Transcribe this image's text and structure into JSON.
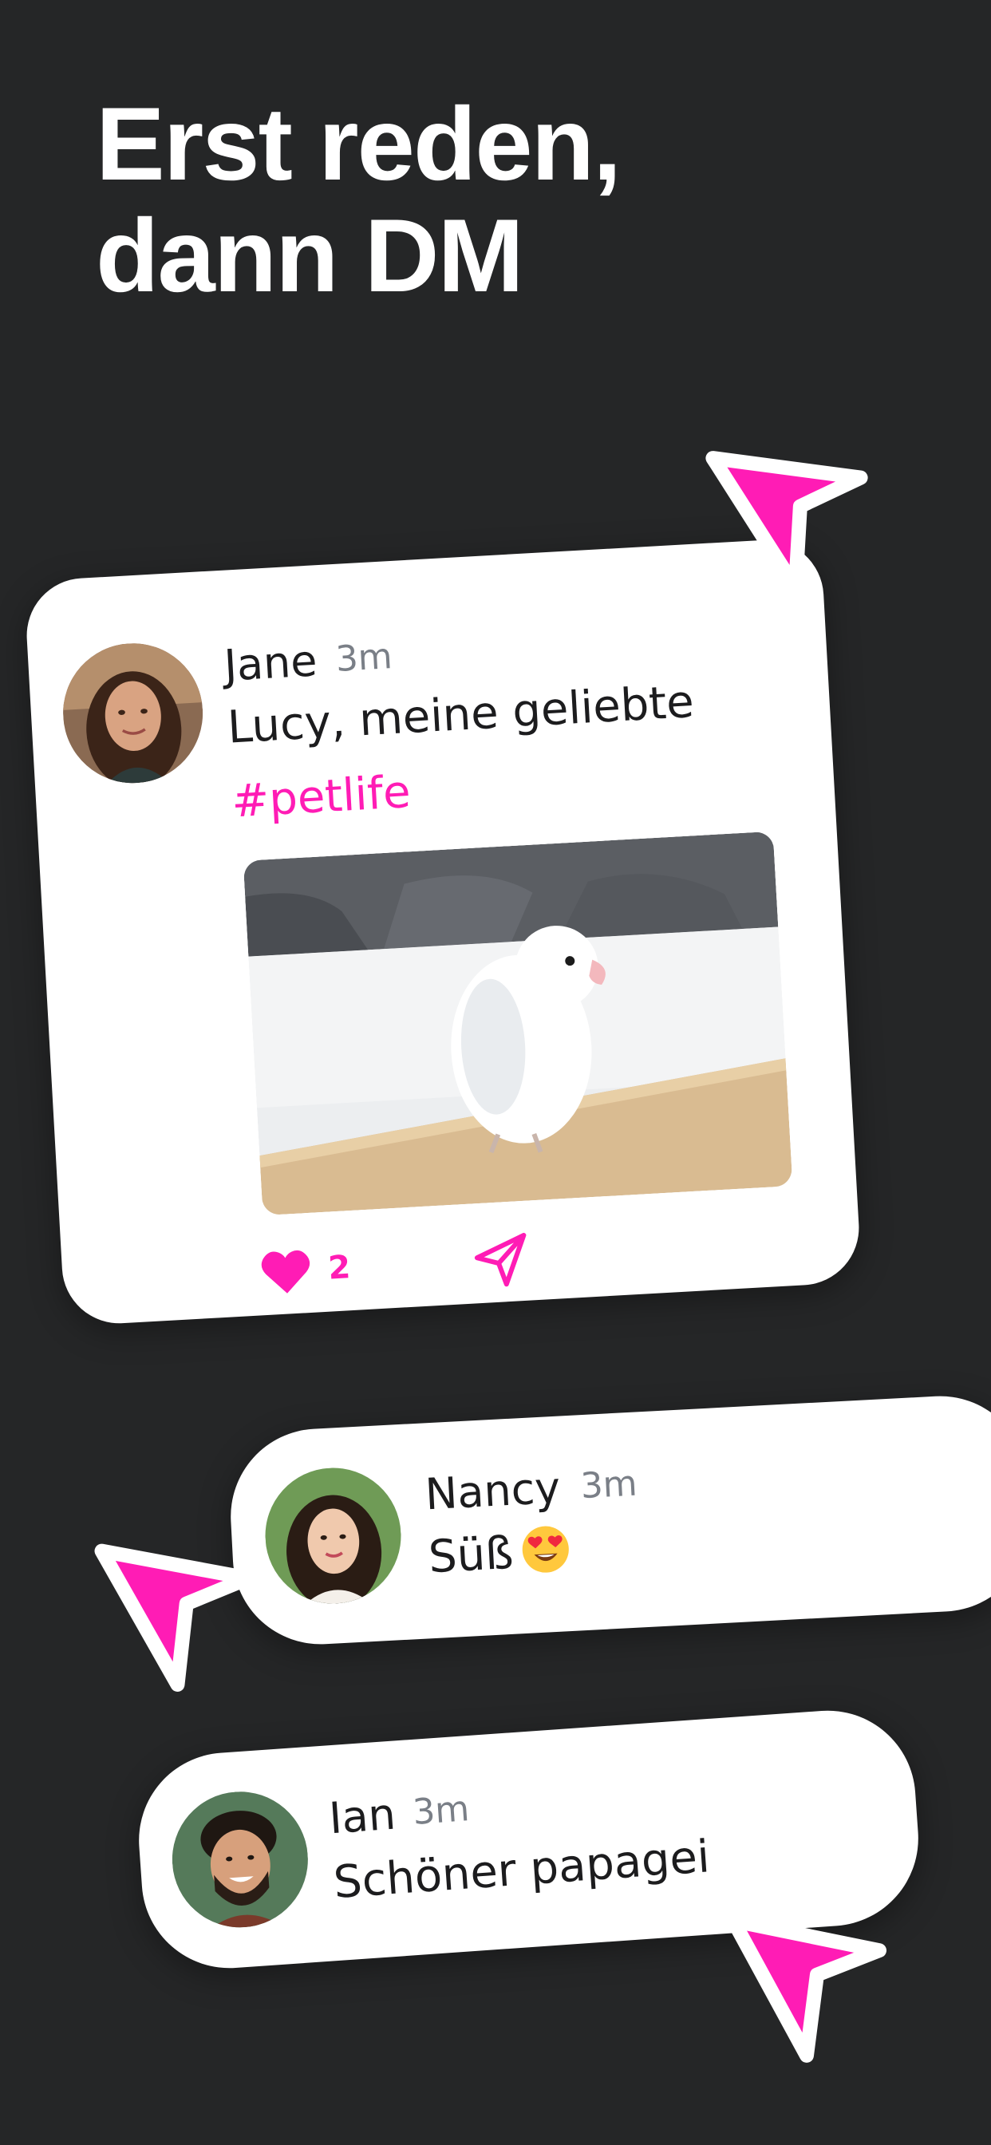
{
  "headline": {
    "line1": "Erst reden,",
    "line2": "dann DM"
  },
  "post": {
    "author": "Jane",
    "time": "3m",
    "text": "Lucy, meine geliebte",
    "hashtag": "#petlife",
    "image_icon": "parrot-photo",
    "like_icon": "heart-icon",
    "like_count": "2",
    "share_icon": "send-icon"
  },
  "comments": [
    {
      "author": "Nancy",
      "time": "3m",
      "text": "Süß",
      "emoji": "heart-eyes-emoji"
    },
    {
      "author": "Ian",
      "time": "3m",
      "text": "Schöner papagei"
    }
  ],
  "colors": {
    "background": "#252627",
    "accent": "#ff1cb5",
    "card": "#ffffff",
    "text": "#1c1c1e",
    "muted": "#7a7f87"
  }
}
